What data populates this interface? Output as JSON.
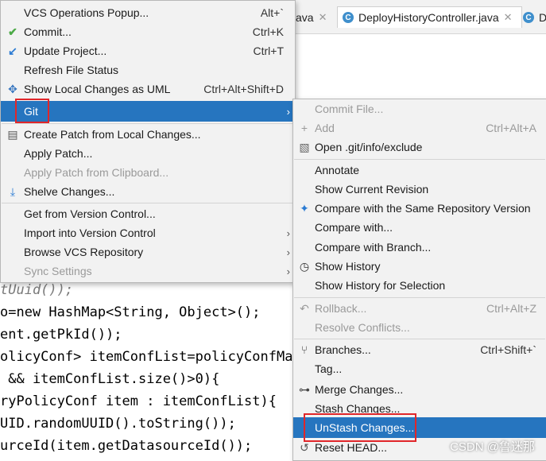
{
  "tabs": [
    {
      "label": "ava"
    },
    {
      "label": "DeployHistoryController.java"
    },
    {
      "label": "D"
    }
  ],
  "code_lines": [
    "tUuid());",
    "o=new HashMap<String, Object>();",
    "ent.getPkId());",
    "olicyConf> itemConfList=policyConfMap",
    " && itemConfList.size()>0){",
    "ryPolicyConf item : itemConfList){",
    "UID.randomUUID().toString());",
    "urceId(item.getDatasourceId());"
  ],
  "vcs_menu": {
    "items": [
      {
        "label": "VCS Operations Popup...",
        "shortcut": "Alt+`"
      },
      {
        "label": "Commit...",
        "shortcut": "Ctrl+K",
        "icon": "check-icon"
      },
      {
        "label": "Update Project...",
        "shortcut": "Ctrl+T",
        "icon": "update-arrow-icon"
      },
      {
        "label": "Refresh File Status"
      },
      {
        "label": "Show Local Changes as UML",
        "shortcut": "Ctrl+Alt+Shift+D",
        "icon": "uml-icon"
      },
      {
        "label": "Git"
      },
      {
        "label": "Create Patch from Local Changes...",
        "icon": "patch-icon"
      },
      {
        "label": "Apply Patch..."
      },
      {
        "label": "Apply Patch from Clipboard..."
      },
      {
        "label": "Shelve Changes...",
        "icon": "shelve-icon"
      },
      {
        "label": "Get from Version Control..."
      },
      {
        "label": "Import into Version Control"
      },
      {
        "label": "Browse VCS Repository"
      },
      {
        "label": "Sync Settings"
      }
    ]
  },
  "git_menu": {
    "items": [
      {
        "label": "Commit File..."
      },
      {
        "label": "Add",
        "shortcut": "Ctrl+Alt+A"
      },
      {
        "label": "Open .git/info/exclude"
      },
      {
        "label": "Annotate"
      },
      {
        "label": "Show Current Revision"
      },
      {
        "label": "Compare with the Same Repository Version"
      },
      {
        "label": "Compare with..."
      },
      {
        "label": "Compare with Branch..."
      },
      {
        "label": "Show History"
      },
      {
        "label": "Show History for Selection"
      },
      {
        "label": "Rollback...",
        "shortcut": "Ctrl+Alt+Z"
      },
      {
        "label": "Resolve Conflicts..."
      },
      {
        "label": "Branches...",
        "shortcut": "Ctrl+Shift+`"
      },
      {
        "label": "Tag..."
      },
      {
        "label": "Merge Changes..."
      },
      {
        "label": "Stash Changes..."
      },
      {
        "label": "UnStash Changes..."
      },
      {
        "label": "Reset HEAD..."
      }
    ]
  },
  "watermark": "CSDN @鲁迷那",
  "colors": {
    "selection": "#2675bf",
    "highlight_box": "#e0262a"
  }
}
